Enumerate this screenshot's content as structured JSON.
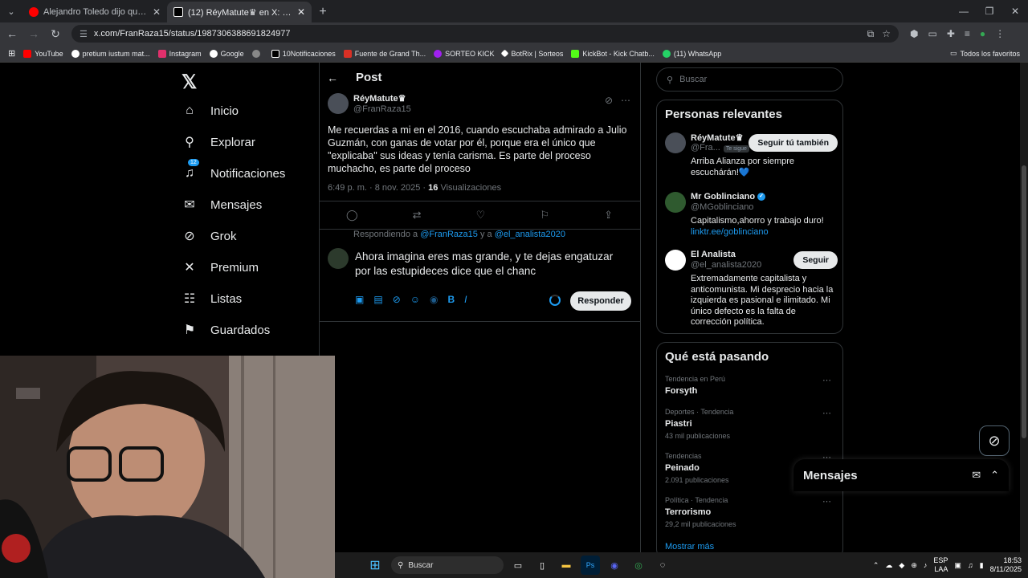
{
  "browser": {
    "tabs": [
      {
        "title": "Alejandro Toledo dijo que recib",
        "active": false,
        "color": "#ff0000"
      },
      {
        "title": "(12) RéyMatute♛ en X: \"@MG",
        "active": true,
        "color": "#ffffff"
      }
    ],
    "url": "x.com/FranRaza15/status/1987306388691824977",
    "bookmarks": [
      {
        "label": "YouTube",
        "color": "#ff0000"
      },
      {
        "label": "pretium iustum mat...",
        "color": "#ffffff"
      },
      {
        "label": "Instagram",
        "color": "#e1306c"
      },
      {
        "label": "Google",
        "color": "#ffffff"
      },
      {
        "label": "",
        "color": "#888888"
      },
      {
        "label": "10Notificaciones",
        "color": "#ffffff"
      },
      {
        "label": "Fuente de Grand Th...",
        "color": "#d93025"
      },
      {
        "label": "SORTEO KICK",
        "color": "#a020f0"
      },
      {
        "label": "BotRix | Sorteos",
        "color": "#ffffff"
      },
      {
        "label": "KickBot - Kick Chatb...",
        "color": "#53fc18"
      },
      {
        "label": "(11) WhatsApp",
        "color": "#25d366"
      }
    ],
    "bookmarks_right": "Todos los favoritos"
  },
  "nav": {
    "items": [
      {
        "label": "Inicio",
        "icon": "home-icon"
      },
      {
        "label": "Explorar",
        "icon": "search-icon"
      },
      {
        "label": "Notificaciones",
        "icon": "bell-icon",
        "badge": "12"
      },
      {
        "label": "Mensajes",
        "icon": "mail-icon"
      },
      {
        "label": "Grok",
        "icon": "grok-icon"
      },
      {
        "label": "Premium",
        "icon": "x-icon"
      },
      {
        "label": "Listas",
        "icon": "list-icon"
      },
      {
        "label": "Guardados",
        "icon": "bookmark-icon"
      }
    ]
  },
  "post": {
    "header": "Post",
    "author_name": "RéyMatute♛",
    "author_handle": "@FranRaza15",
    "text": "Me recuerdas a mi en el 2016, cuando escuchaba admirado a Julio Guzmán, con ganas de votar por él, porque era el único que \"explicaba\" sus ideas y tenía carisma. Es parte del proceso muchacho, es parte del proceso",
    "time": "6:49 p. m. · 8 nov. 2025 ·",
    "views_count": "16",
    "views_label": "Visualizaciones"
  },
  "reply": {
    "replying_prefix": "Respondiendo a",
    "replying_to_1": "@FranRaza15",
    "replying_and": "y a",
    "replying_to_2": "@el_analista2020",
    "draft_text": "Ahora imagina eres mas grande, y te dejas engatuzar por las estupideces dice que el chanc",
    "button": "Responder"
  },
  "right": {
    "search_placeholder": "Buscar",
    "relevant_title": "Personas relevantes",
    "people": [
      {
        "name": "RéyMatute♛",
        "handle": "@Fra...",
        "tag": "Te sigue",
        "button": "Seguir tú también",
        "bio": "Arriba Alianza por siempre escuchárán!💙",
        "link": ""
      },
      {
        "name": "Mr Goblinciano",
        "handle": "@MGoblinciano",
        "verified": true,
        "button": "",
        "bio": "Capitalismo,ahorro y trabajo duro!",
        "link": "linktr.ee/goblinciano"
      },
      {
        "name": "El Analista",
        "handle": "@el_analista2020",
        "button": "Seguir",
        "bio": "Extremadamente capitalista y anticomunista. Mi desprecio hacia la izquierda es pasional e ilimitado. Mi único defecto es la falta de corrección política.",
        "link": ""
      }
    ],
    "trending_title": "Qué está pasando",
    "trends": [
      {
        "category": "Tendencia en Perú",
        "name": "Forsyth",
        "count": ""
      },
      {
        "category": "Deportes · Tendencia",
        "name": "Piastri",
        "count": "43 mil publicaciones"
      },
      {
        "category": "Tendencias",
        "name": "Peinado",
        "count": "2.091 publicaciones"
      },
      {
        "category": "Política · Tendencia",
        "name": "Terrorismo",
        "count": "29,2 mil publicaciones"
      }
    ],
    "show_more": "Mostrar más",
    "messages_dock": "Mensajes"
  },
  "taskbar": {
    "search": "Buscar",
    "lang_1": "ESP",
    "lang_2": "LAA",
    "time": "18:53",
    "date": "8/11/2025"
  }
}
